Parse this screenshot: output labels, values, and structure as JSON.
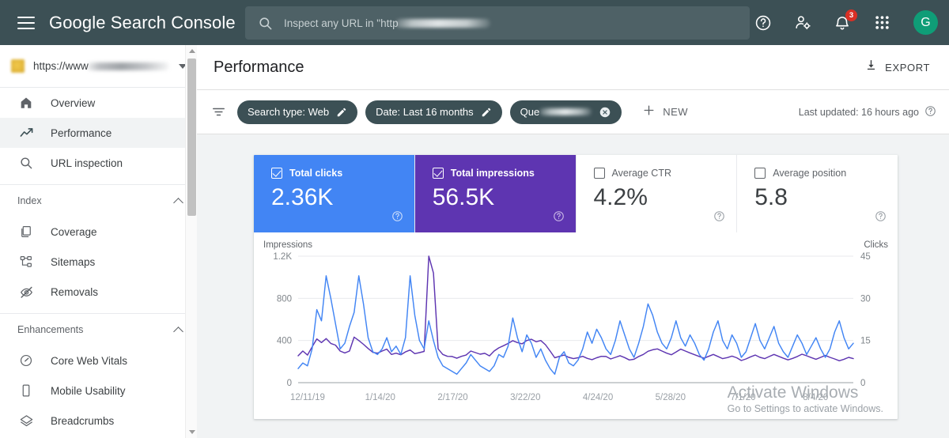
{
  "topbar": {
    "brand": "Google Search Console",
    "menu_icon": "hamburger-icon",
    "search": {
      "placeholder": "Inspect any URL in \"http",
      "icon": "search-icon",
      "redacted": true
    },
    "help_icon": "help-circle-icon",
    "account_settings_icon": "person-gear-icon",
    "notifications_icon": "bell-icon",
    "notifications_count": "3",
    "apps_icon": "apps-grid-icon",
    "avatar_letter": "G"
  },
  "sidebar": {
    "property": {
      "url": "https://www",
      "redacted": true,
      "dropdown_icon": "chevron-down-icon",
      "favicon": "site-favicon"
    },
    "items": [
      {
        "label": "Overview",
        "icon": "home-icon",
        "active": false
      },
      {
        "label": "Performance",
        "icon": "trending-up-icon",
        "active": true
      },
      {
        "label": "URL inspection",
        "icon": "search-icon",
        "active": false
      }
    ],
    "groups": [
      {
        "label": "Index",
        "collapse_icon": "chevron-up-icon",
        "items": [
          {
            "label": "Coverage",
            "icon": "pages-icon"
          },
          {
            "label": "Sitemaps",
            "icon": "sitemap-icon"
          },
          {
            "label": "Removals",
            "icon": "eye-off-icon"
          }
        ]
      },
      {
        "label": "Enhancements",
        "collapse_icon": "chevron-up-icon",
        "items": [
          {
            "label": "Core Web Vitals",
            "icon": "speedometer-icon"
          },
          {
            "label": "Mobile Usability",
            "icon": "mobile-icon"
          },
          {
            "label": "Breadcrumbs",
            "icon": "layers-icon"
          }
        ]
      }
    ],
    "scrollbar": {
      "up_icon": "scroll-up-arrow",
      "down_icon": "scroll-down-arrow"
    }
  },
  "page": {
    "title": "Performance",
    "export_label": "EXPORT",
    "export_icon": "download-icon"
  },
  "filters": {
    "filter_icon": "filter-icon",
    "chips": [
      {
        "label": "Search type: Web",
        "edit_icon": "pencil-icon",
        "removable": false,
        "redacted": false
      },
      {
        "label": "Date: Last 16 months",
        "edit_icon": "pencil-icon",
        "removable": false,
        "redacted": false
      },
      {
        "label": "Que",
        "close_icon": "close-circle-icon",
        "removable": true,
        "redacted": true
      }
    ],
    "new_label": "NEW",
    "new_icon": "plus-icon",
    "last_updated": "Last updated: 16 hours ago",
    "last_updated_help_icon": "help-circle-icon"
  },
  "metrics": [
    {
      "label": "Total clicks",
      "value": "2.36K",
      "selected": true,
      "color": "#4285f4",
      "help_icon": "help-circle-icon"
    },
    {
      "label": "Total impressions",
      "value": "56.5K",
      "selected": true,
      "color": "#5e35b1",
      "help_icon": "help-circle-icon"
    },
    {
      "label": "Average CTR",
      "value": "4.2%",
      "selected": false,
      "color": "#ffffff",
      "help_icon": "help-circle-icon"
    },
    {
      "label": "Average position",
      "value": "5.8",
      "selected": false,
      "color": "#ffffff",
      "help_icon": "help-circle-icon"
    }
  ],
  "watermark": {
    "line1": "Activate Windows",
    "line2": "Go to Settings to activate Windows."
  },
  "chart_data": {
    "type": "line",
    "title": "",
    "xlabel": "",
    "ylabel": "Impressions",
    "y2label": "Clicks",
    "ylim": [
      0,
      1200
    ],
    "y2lim": [
      0,
      45
    ],
    "yticks": [
      "0",
      "400",
      "800",
      "1.2K"
    ],
    "y2ticks": [
      "0",
      "15",
      "30",
      "45"
    ],
    "xticks": [
      "12/11/19",
      "1/14/20",
      "2/17/20",
      "3/22/20",
      "4/24/20",
      "5/28/20",
      "7/1/20",
      "8/4/20"
    ],
    "grid": true,
    "legend_position": "none",
    "series": [
      {
        "name": "Impressions",
        "color": "#5e35b1",
        "axis": "left",
        "values": [
          255,
          300,
          262,
          340,
          415,
          380,
          418,
          372,
          356,
          300,
          282,
          300,
          432,
          400,
          364,
          324,
          288,
          280,
          300,
          318,
          268,
          280,
          265,
          292,
          310,
          275,
          285,
          296,
          1200,
          1040,
          320,
          268,
          250,
          248,
          232,
          250,
          262,
          300,
          285,
          270,
          278,
          254,
          300,
          330,
          350,
          372,
          398,
          380,
          368,
          400,
          412,
          388,
          400,
          360,
          300,
          236,
          250,
          262,
          240,
          228,
          236,
          250,
          230,
          218,
          236,
          250,
          248,
          225,
          240,
          256,
          238,
          215,
          222,
          248,
          268,
          298,
          312,
          320,
          300,
          280,
          265,
          290,
          318,
          300,
          282,
          265,
          248,
          232,
          250,
          268,
          248,
          228,
          238,
          252,
          236,
          210,
          225,
          245,
          262,
          240,
          228,
          248,
          268,
          250,
          232,
          216,
          230,
          248,
          270,
          255,
          238,
          222,
          240,
          258,
          240,
          225,
          208,
          222,
          240,
          228
        ]
      },
      {
        "name": "Clicks",
        "color": "#4285f4",
        "axis": "right",
        "values": [
          5,
          7,
          6,
          12,
          26,
          22,
          38,
          30,
          21,
          12,
          14,
          20,
          25,
          38,
          28,
          16,
          11,
          10,
          12,
          16,
          11,
          13,
          10,
          16,
          38,
          24,
          15,
          12,
          22,
          15,
          9,
          6,
          5,
          4,
          3,
          5,
          7,
          10,
          8,
          6,
          5,
          4,
          6,
          10,
          9,
          13,
          23,
          16,
          11,
          17,
          14,
          9,
          12,
          8,
          5,
          3,
          9,
          11,
          7,
          6,
          8,
          12,
          18,
          14,
          19,
          16,
          12,
          10,
          15,
          22,
          17,
          12,
          9,
          14,
          20,
          28,
          24,
          18,
          14,
          12,
          16,
          22,
          16,
          13,
          17,
          14,
          10,
          8,
          12,
          18,
          22,
          15,
          12,
          17,
          14,
          9,
          11,
          16,
          21,
          15,
          12,
          16,
          20,
          14,
          11,
          9,
          13,
          17,
          14,
          10,
          13,
          16,
          12,
          9,
          12,
          18,
          22,
          16,
          12,
          14
        ]
      }
    ]
  }
}
